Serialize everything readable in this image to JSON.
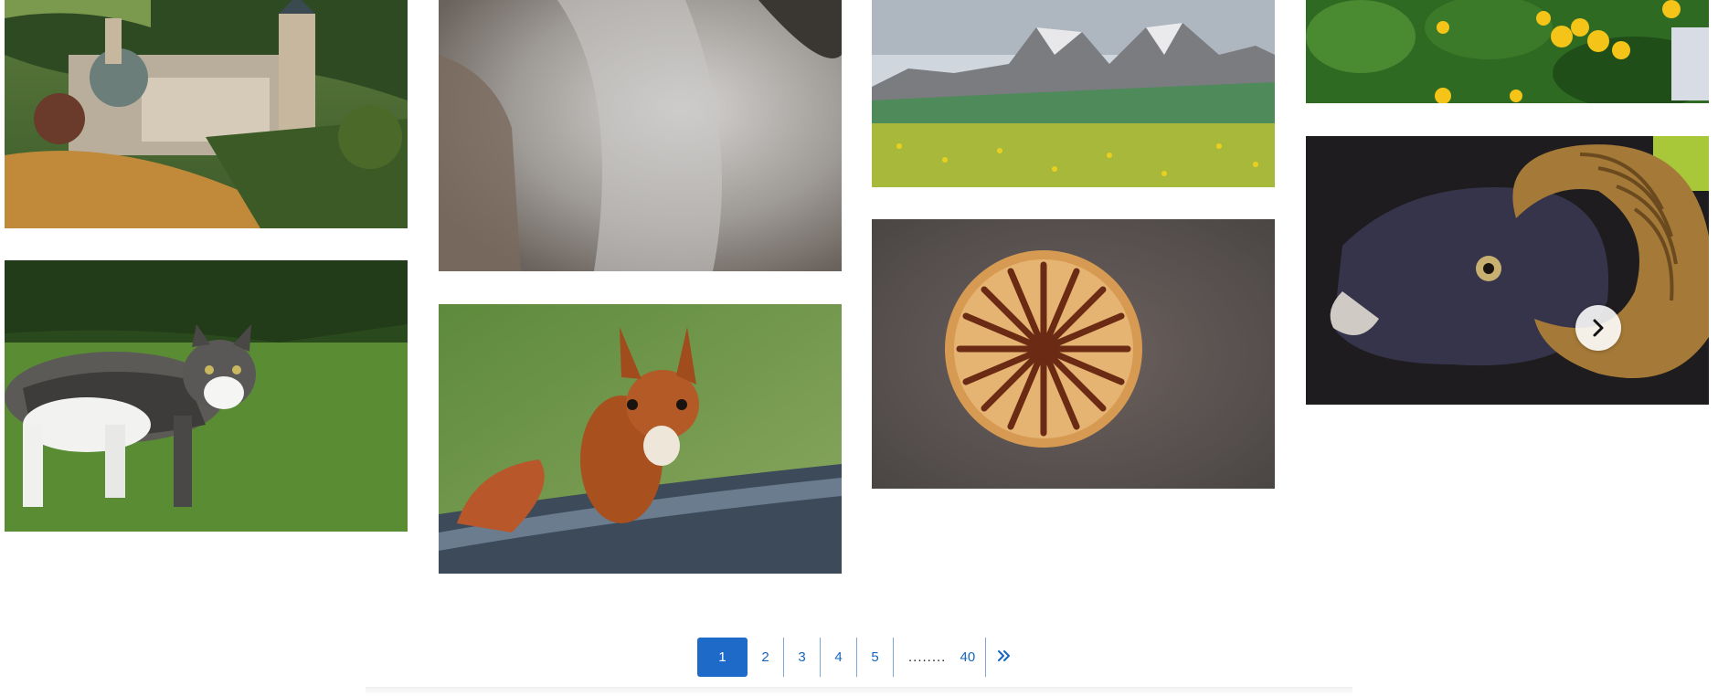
{
  "gallery": {
    "columns": [
      {
        "name": "column-1",
        "photos": [
          {
            "subject": "monastery-in-valley"
          },
          {
            "subject": "tabby-white-cat-on-grass"
          }
        ]
      },
      {
        "name": "column-2",
        "photos": [
          {
            "subject": "grey-fur-closeup"
          },
          {
            "subject": "red-squirrel-on-log"
          }
        ]
      },
      {
        "name": "column-3",
        "photos": [
          {
            "subject": "dolomite-mountains-meadow"
          },
          {
            "subject": "poppy-seed-head-top"
          }
        ]
      },
      {
        "name": "column-4",
        "photos": [
          {
            "subject": "yellow-flowers-green-leaves"
          },
          {
            "subject": "mouflon-ram-with-horns"
          }
        ]
      }
    ],
    "next_icon": "chevron-right-icon"
  },
  "pagination": {
    "pages": [
      "1",
      "2",
      "3",
      "4",
      "5"
    ],
    "active": "1",
    "ellipsis": "........",
    "last_page": "40",
    "next_all_icon": "double-chevron-right-icon"
  },
  "colors": {
    "active_page_bg": "#1e6ac9",
    "page_link": "#1565c0",
    "separator": "#7fa6d6"
  }
}
